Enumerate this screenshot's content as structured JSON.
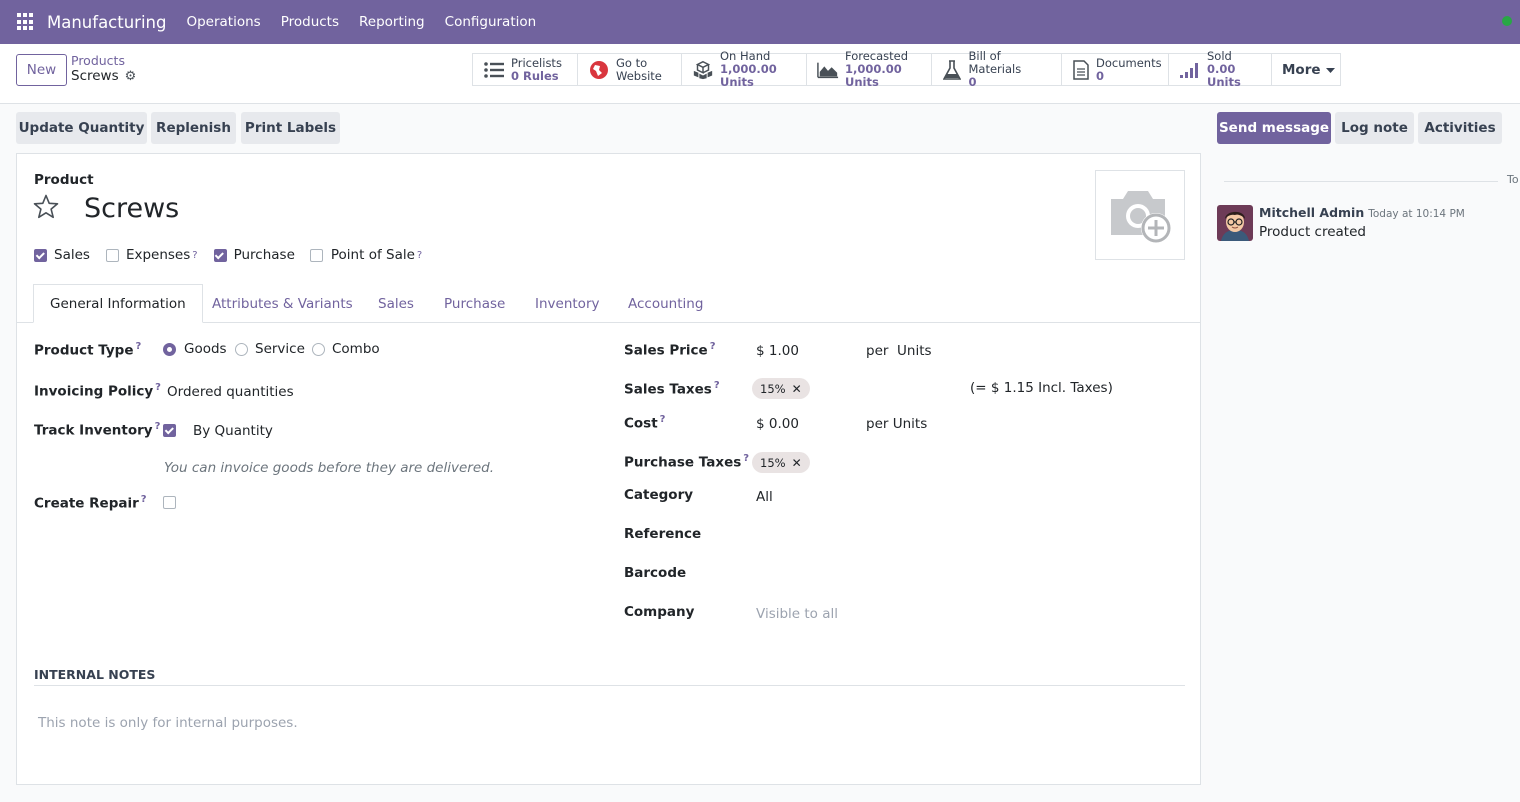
{
  "navbar": {
    "app_name": "Manufacturing",
    "menu": [
      "Operations",
      "Products",
      "Reporting",
      "Configuration"
    ],
    "accent_color": "#71639e"
  },
  "control_panel": {
    "new_label": "New",
    "breadcrumb_parent": "Products",
    "breadcrumb_current": "Screws",
    "stats": [
      {
        "icon": "list-icon",
        "label": "Pricelists",
        "value": "0 Rules"
      },
      {
        "icon": "globe-icon",
        "label": "Go to",
        "value": "Website"
      },
      {
        "icon": "cubes-icon",
        "label": "On Hand",
        "value": "1,000.00 Units"
      },
      {
        "icon": "area-chart-icon",
        "label": "Forecasted",
        "value": "1,000.00 Units"
      },
      {
        "icon": "flask-icon",
        "label": "Bill of Materials",
        "value": "0"
      },
      {
        "icon": "document-icon",
        "label": "Documents",
        "value": "0"
      },
      {
        "icon": "signal-icon",
        "label": "Sold",
        "value": "0.00 Units"
      }
    ],
    "more_label": "More"
  },
  "actions": {
    "update_quantity": "Update Quantity",
    "replenish": "Replenish",
    "print_labels": "Print Labels",
    "send_message": "Send message",
    "log_note": "Log note",
    "activities": "Activities"
  },
  "form": {
    "product_label": "Product",
    "product_name": "Screws",
    "flags": [
      {
        "label": "Sales",
        "checked": true,
        "help": false
      },
      {
        "label": "Expenses",
        "checked": false,
        "help": true
      },
      {
        "label": "Purchase",
        "checked": true,
        "help": false
      },
      {
        "label": "Point of Sale",
        "checked": false,
        "help": true
      }
    ],
    "tabs": [
      "General Information",
      "Attributes & Variants",
      "Sales",
      "Purchase",
      "Inventory",
      "Accounting"
    ],
    "active_tab": "General Information",
    "product_type_label": "Product Type",
    "product_type_options": [
      "Goods",
      "Service",
      "Combo"
    ],
    "product_type_selected": "Goods",
    "invoicing_policy_label": "Invoicing Policy",
    "invoicing_policy_value": "Ordered quantities",
    "track_inventory_label": "Track Inventory",
    "track_inventory_value": "By Quantity",
    "invoice_hint": "You can invoice goods before they are delivered.",
    "create_repair_label": "Create Repair",
    "sales_price_label": "Sales Price",
    "sales_price_value": "$ 1.00",
    "sales_price_per": "per  Units",
    "sales_taxes_label": "Sales Taxes",
    "sales_tax_tag": "15%",
    "incl_taxes": "(= $ 1.15 Incl. Taxes)",
    "cost_label": "Cost",
    "cost_value": "$ 0.00",
    "cost_per": "per Units",
    "purchase_taxes_label": "Purchase Taxes",
    "purchase_tax_tag": "15%",
    "category_label": "Category",
    "category_value": "All",
    "reference_label": "Reference",
    "barcode_label": "Barcode",
    "company_label": "Company",
    "company_placeholder": "Visible to all",
    "internal_notes_title": "INTERNAL NOTES",
    "internal_notes_placeholder": "This note is only for internal purposes."
  },
  "chatter": {
    "date_separator": "To",
    "author": "Mitchell Admin",
    "time": "Today at 10:14 PM",
    "message": "Product created"
  }
}
